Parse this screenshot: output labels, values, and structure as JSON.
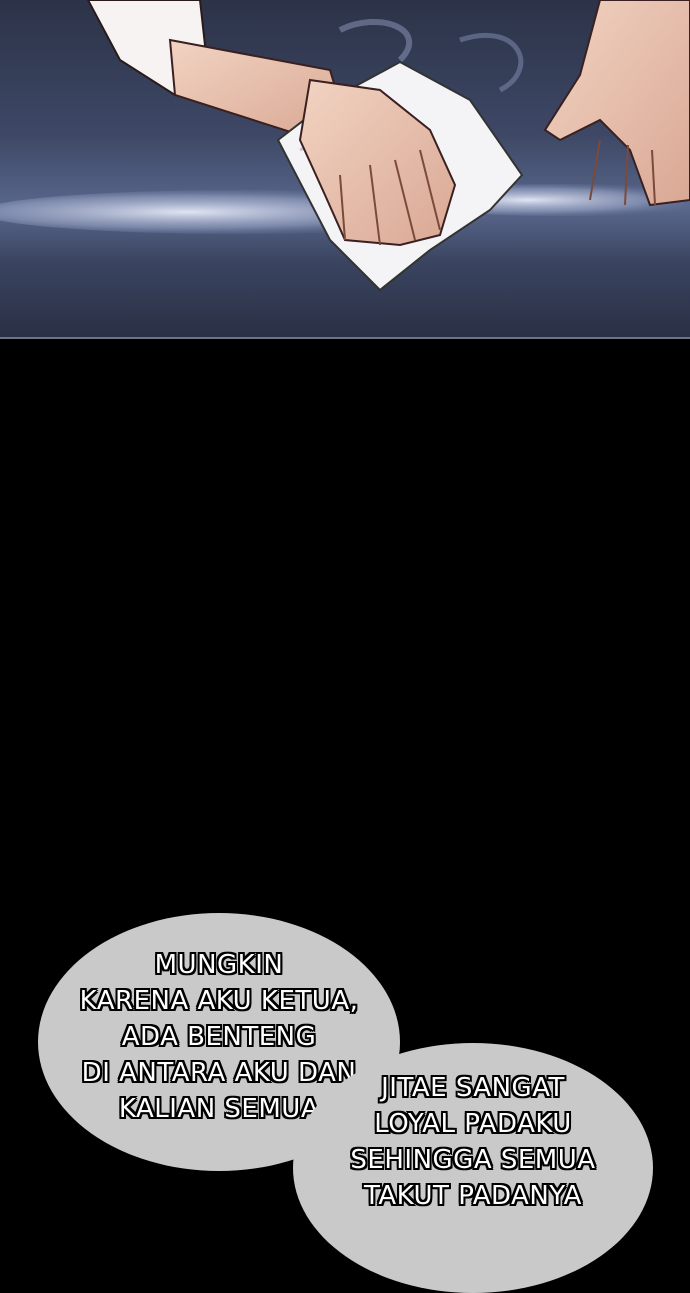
{
  "comic": {
    "panel": {
      "illustration": "hands-wiping-table-with-cloth"
    },
    "bubbles": [
      {
        "text": "MUNGKIN\nKARENA AKU KETUA,\nADA BENTENG\nDI ANTARA AKU DAN\nKALIAN SEMUA"
      },
      {
        "text": "JITAE SANGAT\nLOYAL PADAKU\nSEHINGGA SEMUA\nTAKUT PADANYA"
      }
    ],
    "colors": {
      "background": "#000000",
      "bubble": "#c9c9c9",
      "text": "#ffffff",
      "text_outline": "#000000",
      "table": "#59678c"
    }
  }
}
